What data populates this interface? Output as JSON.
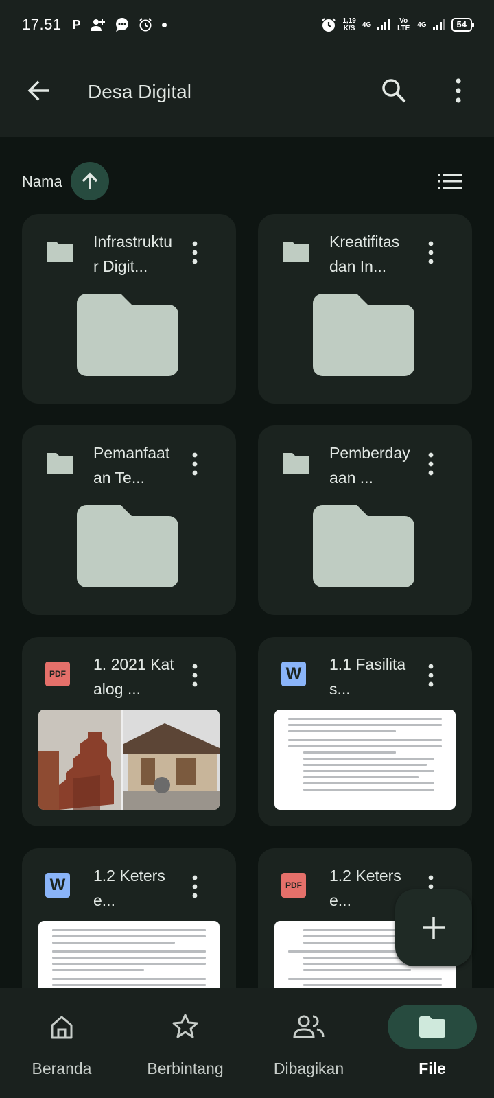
{
  "status_bar": {
    "time": "17.51",
    "speed_value": "1,19",
    "speed_unit": "K/S",
    "network_1": "4G",
    "volte": "Vo LTE",
    "network_2": "4G",
    "battery": "54"
  },
  "top_bar": {
    "title": "Desa Digital",
    "back_icon": "arrow-back-icon",
    "search_icon": "search-icon",
    "more_icon": "more-vert-icon"
  },
  "sort": {
    "label": "Nama",
    "direction_icon": "arrow-up-icon",
    "view_icon": "list-view-icon"
  },
  "items": [
    {
      "type": "folder",
      "name": "Infrastruktur Digit..."
    },
    {
      "type": "folder",
      "name": "Kreatifitas dan In..."
    },
    {
      "type": "folder",
      "name": "Pemanfaatan Te..."
    },
    {
      "type": "folder",
      "name": "Pemberdayaan ..."
    },
    {
      "type": "pdf",
      "badge": "PDF",
      "name": "1. 2021 Katalog ..."
    },
    {
      "type": "word",
      "badge": "W",
      "name": "1.1 Fasilitas..."
    },
    {
      "type": "word",
      "badge": "W",
      "name": "1.2 Keterse..."
    },
    {
      "type": "pdf",
      "badge": "PDF",
      "name": "1.2 Keterse..."
    }
  ],
  "fab": {
    "icon": "plus-icon"
  },
  "bottom_nav": [
    {
      "label": "Beranda",
      "icon": "home-icon",
      "active": false
    },
    {
      "label": "Berbintang",
      "icon": "star-icon",
      "active": false
    },
    {
      "label": "Dibagikan",
      "icon": "people-icon",
      "active": false
    },
    {
      "label": "File",
      "icon": "folder-icon",
      "active": true
    }
  ],
  "colors": {
    "background": "#0e1512",
    "surface": "#1b231f",
    "accent": "#274b3f",
    "folder": "#bfccc2"
  }
}
